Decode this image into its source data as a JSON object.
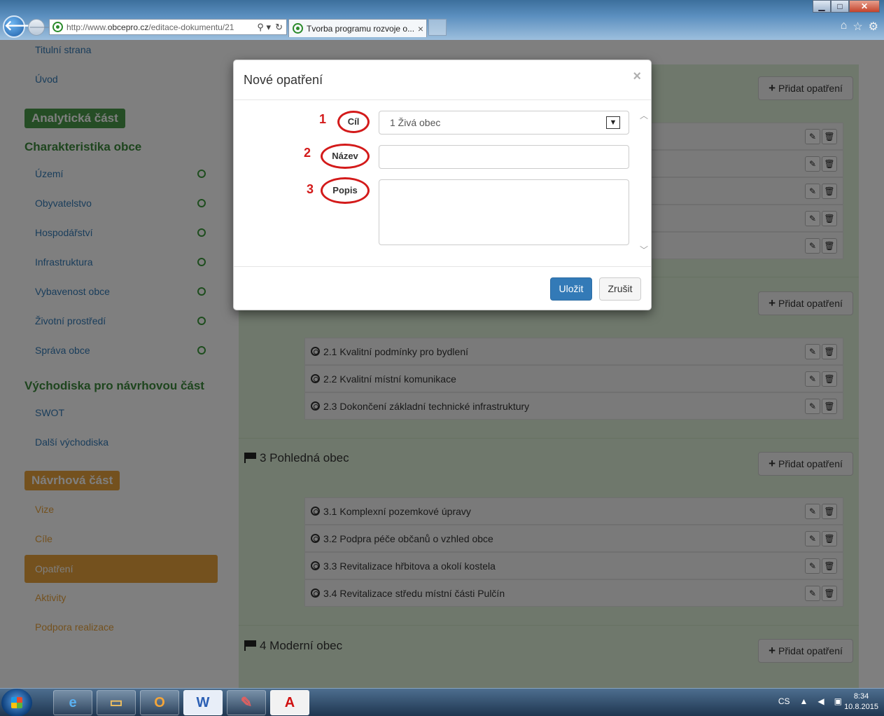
{
  "browser": {
    "url_prefix": "http://www.",
    "url_domain": "obcepro.cz",
    "url_path": "/editace-dokumentu/21",
    "tab_title": "Tvorba programu rozvoje o...",
    "tab_close": "×",
    "addr_search": "⚲ ▾",
    "addr_refresh": "↻",
    "tools": {
      "home": "⌂",
      "favorites": "☆",
      "settings": "⚙"
    },
    "window": {
      "minimize": "▁",
      "maximize": "□",
      "close": "✕"
    }
  },
  "sidebar": {
    "top_links": [
      "Titulní strana",
      "Úvod"
    ],
    "analytic_badge": "Analytická část",
    "characteristics_heading": "Charakteristika obce",
    "characteristics_items": [
      "Území",
      "Obyvatelstvo",
      "Hospodářství",
      "Infrastruktura",
      "Vybavenost obce",
      "Životní prostředí",
      "Správa obce"
    ],
    "basis_heading": "Východiska pro návrhovou část",
    "basis_items": [
      "SWOT",
      "Další východiska"
    ],
    "proposal_badge": "Návrhová část",
    "proposal_items": [
      "Vize",
      "Cíle",
      "Opatření",
      "Aktivity",
      "Podpora realizace"
    ],
    "active_item": "Opatření"
  },
  "content": {
    "add_button_label": "Přidat opatření",
    "section3_title": "3 Pohledná obec",
    "section4_title": "4 Moderní obec",
    "section2_rows": [
      "2.1 Kvalitní podmínky pro bydlení",
      "2.2 Kvalitní místní komunikace",
      "2.3 Dokončení základní technické infrastruktury"
    ],
    "section3_rows": [
      "3.1 Komplexní pozemkové úpravy",
      "3.2 Podpra péče občanů o vzhled obce",
      "3.3 Revitalizace hřbitova a okolí kostela",
      "3.4 Revitalizace středu místní části Pulčín"
    ],
    "edit_icon": "✎",
    "delete_icon": "🗑"
  },
  "modal": {
    "title": "Nové opatření",
    "close": "×",
    "numbers": [
      "1",
      "2",
      "3"
    ],
    "labels": [
      "Cíl",
      "Název",
      "Popis"
    ],
    "goal_selected": "1 Živá obec",
    "save_label": "Uložit",
    "cancel_label": "Zrušit"
  },
  "taskbar": {
    "lang": "CS",
    "time": "8:34",
    "date": "10.8.2015"
  }
}
